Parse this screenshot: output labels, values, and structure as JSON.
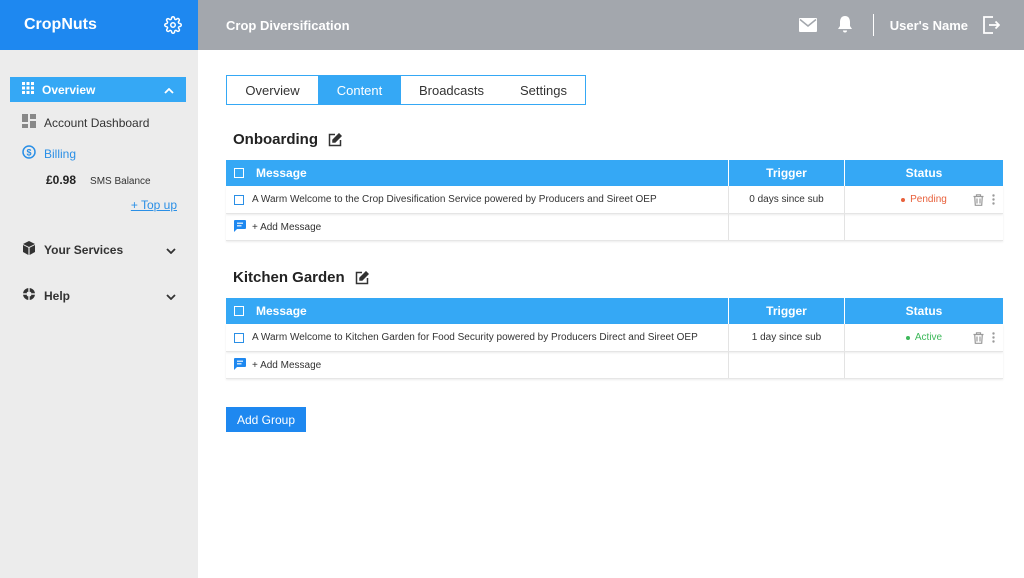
{
  "app": {
    "brand": "CropNuts",
    "page_title": "Crop Diversification",
    "user_name": "User's Name"
  },
  "sidebar": {
    "overview_label": "Overview",
    "account_dashboard_label": "Account Dashboard",
    "billing_label": "Billing",
    "sms_amount": "£0.98",
    "sms_label": "SMS Balance",
    "topup_label": "+ Top up",
    "services_label": "Your Services",
    "help_label": "Help"
  },
  "tabs": [
    {
      "label": "Overview",
      "active": false
    },
    {
      "label": "Content",
      "active": true
    },
    {
      "label": "Broadcasts",
      "active": false
    },
    {
      "label": "Settings",
      "active": false
    }
  ],
  "table_headers": {
    "message": "Message",
    "trigger": "Trigger",
    "status": "Status"
  },
  "groups": [
    {
      "title": "Onboarding",
      "rows": [
        {
          "message": "A Warm Welcome to the Crop Divesification Service powered by Producers and Sireet OEP",
          "trigger": "0 days since sub",
          "status": "Pending"
        }
      ],
      "add_label": "+ Add Message"
    },
    {
      "title": "Kitchen Garden",
      "rows": [
        {
          "message": "A Warm Welcome to Kitchen Garden for Food Security powered by Producers Direct and Sireet OEP",
          "trigger": "1 day since sub",
          "status": "Active"
        }
      ],
      "add_label": "+ Add Message"
    }
  ],
  "add_group_label": "Add Group",
  "colors": {
    "brand_blue": "#1e88f0",
    "accent_blue": "#35a8f5",
    "header_gray": "#a3a7ad",
    "sidebar_bg": "#ececec",
    "pending": "#e8613c",
    "active": "#3db85a"
  },
  "icons": {
    "settings": "gear-icon",
    "mail": "mail-icon",
    "notifications": "bell-icon",
    "logout": "logout-icon",
    "overview": "grid-icon",
    "dashboard": "dashboard-icon",
    "billing": "dollar-circle-icon",
    "services": "box-icon",
    "help": "lifebuoy-icon",
    "edit": "edit-icon",
    "add_message": "chat-icon",
    "delete": "trash-icon",
    "more": "more-vertical-icon"
  }
}
